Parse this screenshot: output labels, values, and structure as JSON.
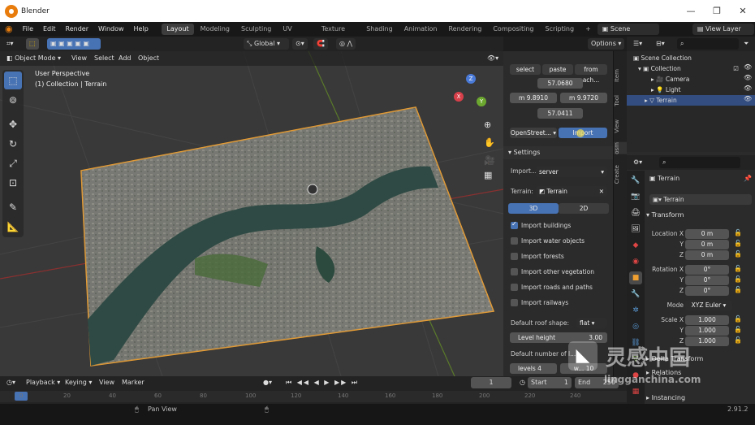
{
  "window": {
    "title": "Blender",
    "minimize": "—",
    "maximize": "❐",
    "close": "✕"
  },
  "menu": {
    "items": [
      "File",
      "Edit",
      "Render",
      "Window",
      "Help"
    ]
  },
  "workspaces": [
    "Layout",
    "Modeling",
    "Sculpting",
    "UV Editing",
    "Texture Paint",
    "Shading",
    "Animation",
    "Rendering",
    "Compositing",
    "Scripting"
  ],
  "active_workspace": "Layout",
  "add_workspace": "+",
  "scene": {
    "label": "Scene",
    "view_layer": "View Layer"
  },
  "header": {
    "transform_orientation": "Global",
    "options": "Options"
  },
  "viewport_header": {
    "mode": "Object Mode",
    "view": "View",
    "select": "Select",
    "add": "Add",
    "object": "Object"
  },
  "viewport": {
    "perspective": "User Perspective",
    "collection": "(1) Collection | Terrain"
  },
  "gizmo": {
    "x": "X",
    "y": "Y",
    "z": "Z"
  },
  "npanel": {
    "top_buttons": [
      "select",
      "paste",
      "from ach..."
    ],
    "coords": {
      "top": "57.0680",
      "left": "m 9.8910",
      "right": "m 9.9720",
      "bottom": "57.0411"
    },
    "provider": "OpenStreet...",
    "import_button": "Import",
    "settings_title": "Settings",
    "import_label": "Import...",
    "import_value": "server",
    "terrain_label": "Terrain:",
    "terrain_value": "Terrain",
    "mode_3d": "3D",
    "mode_2d": "2D",
    "checks": [
      {
        "label": "Import buildings",
        "on": true
      },
      {
        "label": "Import water objects",
        "on": false
      },
      {
        "label": "Import forests",
        "on": false
      },
      {
        "label": "Import other vegetation",
        "on": false
      },
      {
        "label": "Import roads and paths",
        "on": false
      },
      {
        "label": "Import railways",
        "on": false
      }
    ],
    "roof_label": "Default roof shape:",
    "roof_value": "flat",
    "level_height_label": "Level height",
    "level_height_value": "3.00",
    "default_number_label": "Default number of l...",
    "levels_label": "levels",
    "levels_value": "4",
    "wiggle_label": "w...",
    "wiggle_value": "10"
  },
  "ntabs": [
    "Item",
    "Tool",
    "View",
    "osm",
    "Create"
  ],
  "outliner": {
    "title": "Scene Collection",
    "rows": [
      {
        "label": "Collection",
        "indent": 1
      },
      {
        "label": "Camera",
        "indent": 2
      },
      {
        "label": "Light",
        "indent": 2
      },
      {
        "label": "Terrain",
        "indent": 2
      }
    ]
  },
  "properties": {
    "object_name": "Terrain",
    "data_name": "Terrain",
    "transform_title": "Transform",
    "location": {
      "label": "Location X",
      "y": "Y",
      "z": "Z",
      "values": [
        "0 m",
        "0 m",
        "0 m"
      ]
    },
    "rotation": {
      "label": "Rotation X",
      "y": "Y",
      "z": "Z",
      "values": [
        "0°",
        "0°",
        "0°"
      ]
    },
    "mode_label": "Mode",
    "mode_value": "XYZ Euler",
    "scale": {
      "label": "Scale X",
      "y": "Y",
      "z": "Z",
      "values": [
        "1.000",
        "1.000",
        "1.000"
      ]
    },
    "delta_transform": "Delta Transform",
    "relations": "Relations",
    "instancing": "Instancing"
  },
  "timeline": {
    "playback": "Playback",
    "keying": "Keying",
    "view": "View",
    "marker": "Marker",
    "current_frame": "1",
    "start_label": "Start",
    "start": "1",
    "end_label": "End",
    "end": "250",
    "ticks": [
      "0",
      "20",
      "40",
      "60",
      "80",
      "100",
      "120",
      "140",
      "160",
      "180",
      "200",
      "220",
      "240"
    ]
  },
  "status": {
    "left": "Pan View",
    "version": "2.91.2"
  },
  "watermark": {
    "cn": "灵感中国",
    "url": "lingganchina.com"
  },
  "colors": {
    "accent": "#4772b3",
    "selection": "#f0a030",
    "active_tab": "#3d3d3d"
  }
}
